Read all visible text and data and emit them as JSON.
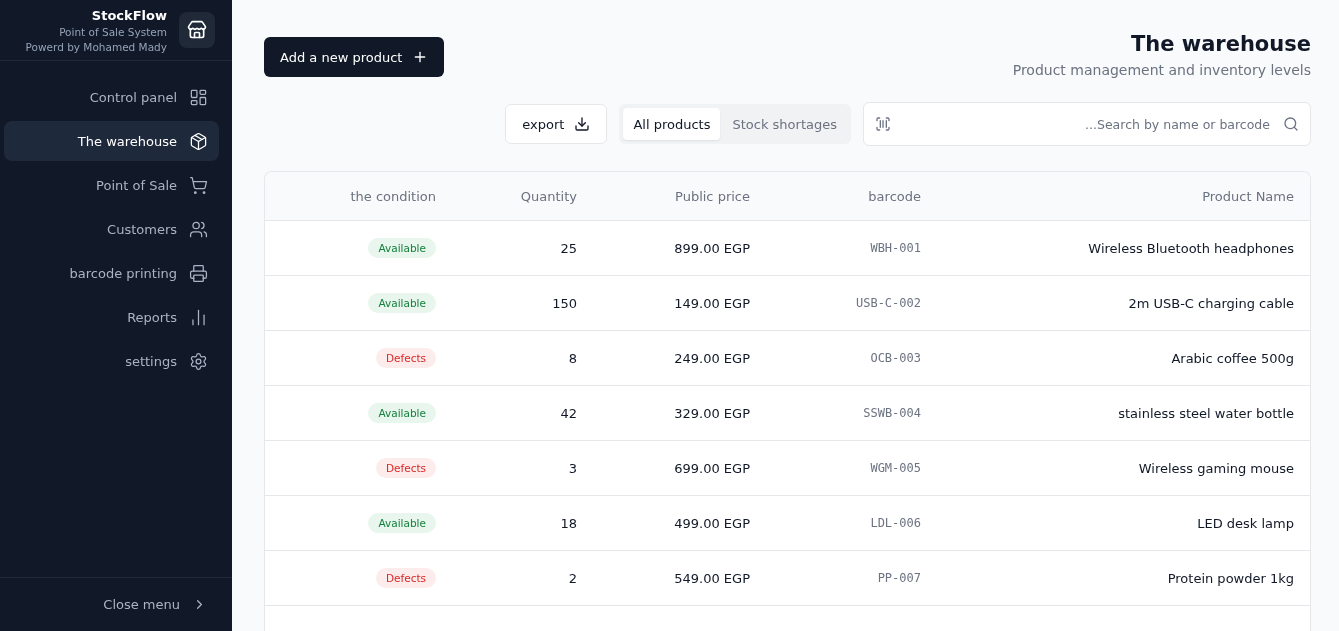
{
  "brand": {
    "name": "StockFlow",
    "subtitle": "Point of Sale System",
    "credit": "Powerd by Mohamed Mady"
  },
  "sidebar": {
    "items": [
      {
        "label": "Control panel",
        "selected": false
      },
      {
        "label": "The warehouse",
        "selected": true
      },
      {
        "label": "Point of Sale",
        "selected": false
      },
      {
        "label": "Customers",
        "selected": false
      },
      {
        "label": "barcode printing",
        "selected": false
      },
      {
        "label": "Reports",
        "selected": false
      },
      {
        "label": "settings",
        "selected": false
      }
    ],
    "close_label": "Close menu"
  },
  "header": {
    "title": "The warehouse",
    "subtitle": "Product management and inventory levels",
    "add_button": "Add a new product"
  },
  "toolbar": {
    "export": "export",
    "filters": [
      {
        "label": "All products",
        "selected": true
      },
      {
        "label": "Stock shortages",
        "selected": false
      }
    ],
    "search": {
      "placeholder": "...Search by name or barcode"
    }
  },
  "table": {
    "columns": [
      "the condition",
      "Quantity",
      "Public price",
      "barcode",
      "Product Name"
    ],
    "rows": [
      {
        "status": {
          "label": "Available",
          "kind": "available"
        },
        "quantity": "25",
        "price": "899.00 EGP",
        "barcode": "WBH-001",
        "name": "Wireless Bluetooth headphones"
      },
      {
        "status": {
          "label": "Available",
          "kind": "available"
        },
        "quantity": "150",
        "price": "149.00 EGP",
        "barcode": "USB-C-002",
        "name": "2m USB-C charging cable"
      },
      {
        "status": {
          "label": "Defects",
          "kind": "defects"
        },
        "quantity": "8",
        "price": "249.00 EGP",
        "barcode": "OCB-003",
        "name": "Arabic coffee 500g"
      },
      {
        "status": {
          "label": "Available",
          "kind": "available"
        },
        "quantity": "42",
        "price": "329.00 EGP",
        "barcode": "SSWB-004",
        "name": "stainless steel water bottle"
      },
      {
        "status": {
          "label": "Defects",
          "kind": "defects"
        },
        "quantity": "3",
        "price": "699.00 EGP",
        "barcode": "WGM-005",
        "name": "Wireless gaming mouse"
      },
      {
        "status": {
          "label": "Available",
          "kind": "available"
        },
        "quantity": "18",
        "price": "499.00 EGP",
        "barcode": "LDL-006",
        "name": "LED desk lamp"
      },
      {
        "status": {
          "label": "Defects",
          "kind": "defects"
        },
        "quantity": "2",
        "price": "549.00 EGP",
        "barcode": "PP-007",
        "name": "Protein powder 1kg"
      }
    ]
  }
}
